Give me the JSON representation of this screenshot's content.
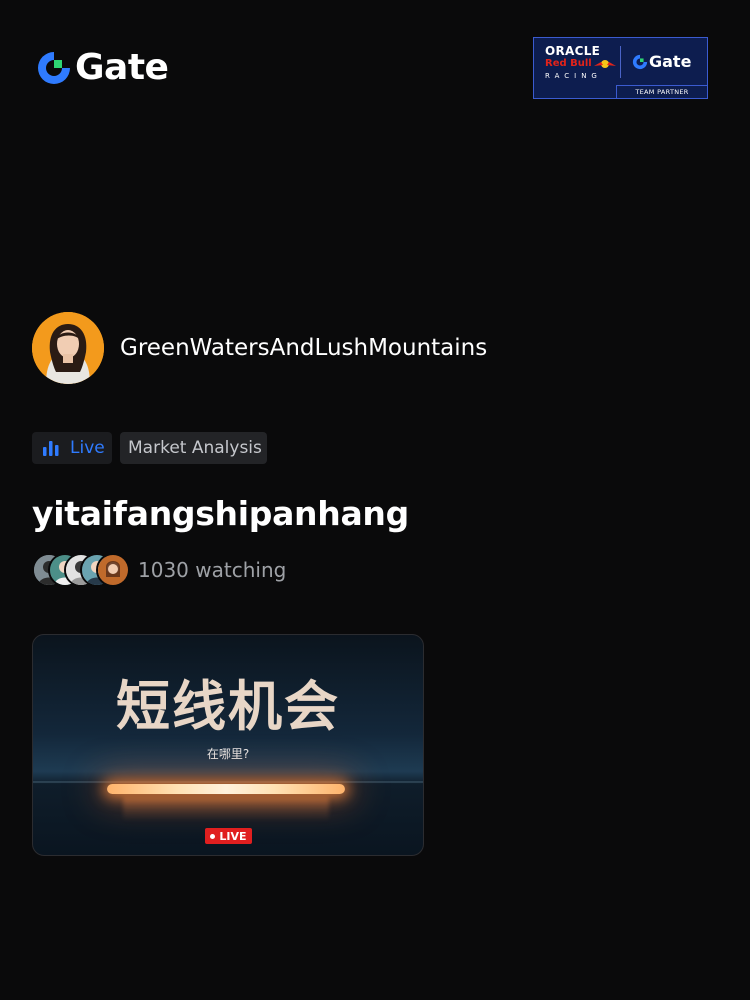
{
  "brand": {
    "name": "Gate"
  },
  "partner": {
    "oracle": "ORACLE",
    "redbull": "Red Bull",
    "racing": "RACING",
    "brand": "Gate",
    "tag": "TEAM PARTNER"
  },
  "host": {
    "name": "GreenWatersAndLushMountains"
  },
  "tags": {
    "live": "Live",
    "category": "Market Analysis"
  },
  "stream": {
    "title": "yitaifangshipanhang",
    "watching": "1030 watching"
  },
  "thumbnail": {
    "headline": "短线机会",
    "subtitle": "在哪里?",
    "badge": "LIVE"
  },
  "colors": {
    "accent": "#2f7bff",
    "brand_green": "#2ed573",
    "live_red": "#e01f1f"
  }
}
